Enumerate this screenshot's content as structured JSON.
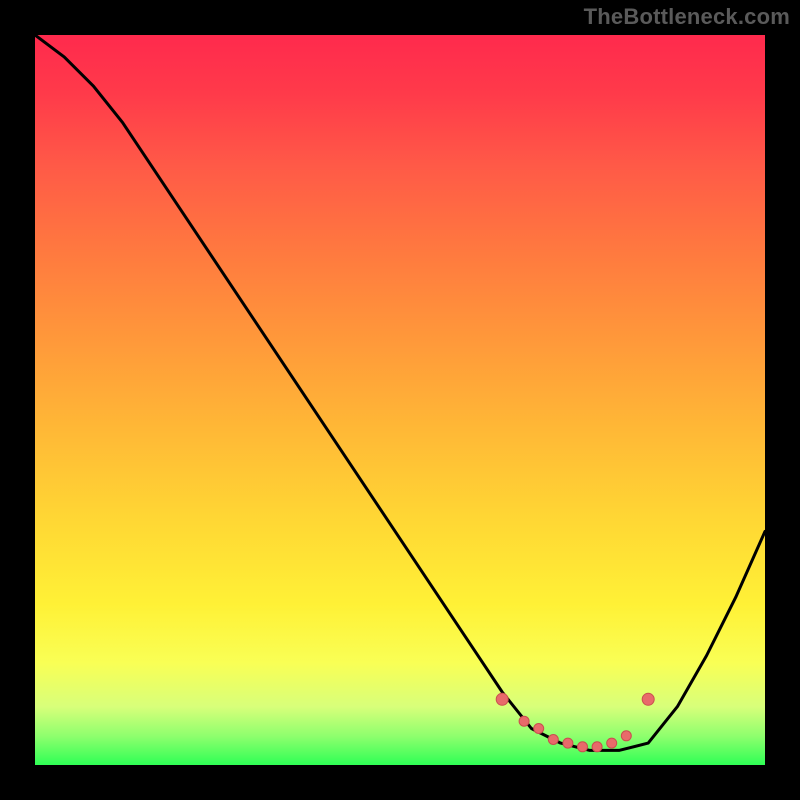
{
  "watermark": "TheBottleneck.com",
  "colors": {
    "curve": "#000000",
    "marker_fill": "#e86a6a",
    "marker_stroke": "#c94f4f"
  },
  "chart_data": {
    "type": "line",
    "title": "",
    "xlabel": "",
    "ylabel": "",
    "xlim": [
      0,
      100
    ],
    "ylim": [
      0,
      100
    ],
    "series": [
      {
        "name": "bottleneck-curve",
        "x": [
          0,
          4,
          8,
          12,
          20,
          30,
          40,
          50,
          60,
          64,
          68,
          72,
          76,
          80,
          84,
          88,
          92,
          96,
          100
        ],
        "y": [
          100,
          97,
          93,
          88,
          76,
          61,
          46,
          31,
          16,
          10,
          5,
          3,
          2,
          2,
          3,
          8,
          15,
          23,
          32
        ]
      }
    ],
    "markers": {
      "name": "valley-markers",
      "x": [
        64,
        67,
        69,
        71,
        73,
        75,
        77,
        79,
        81,
        84
      ],
      "y": [
        9,
        6,
        5,
        3.5,
        3,
        2.5,
        2.5,
        3,
        4,
        9
      ]
    }
  }
}
